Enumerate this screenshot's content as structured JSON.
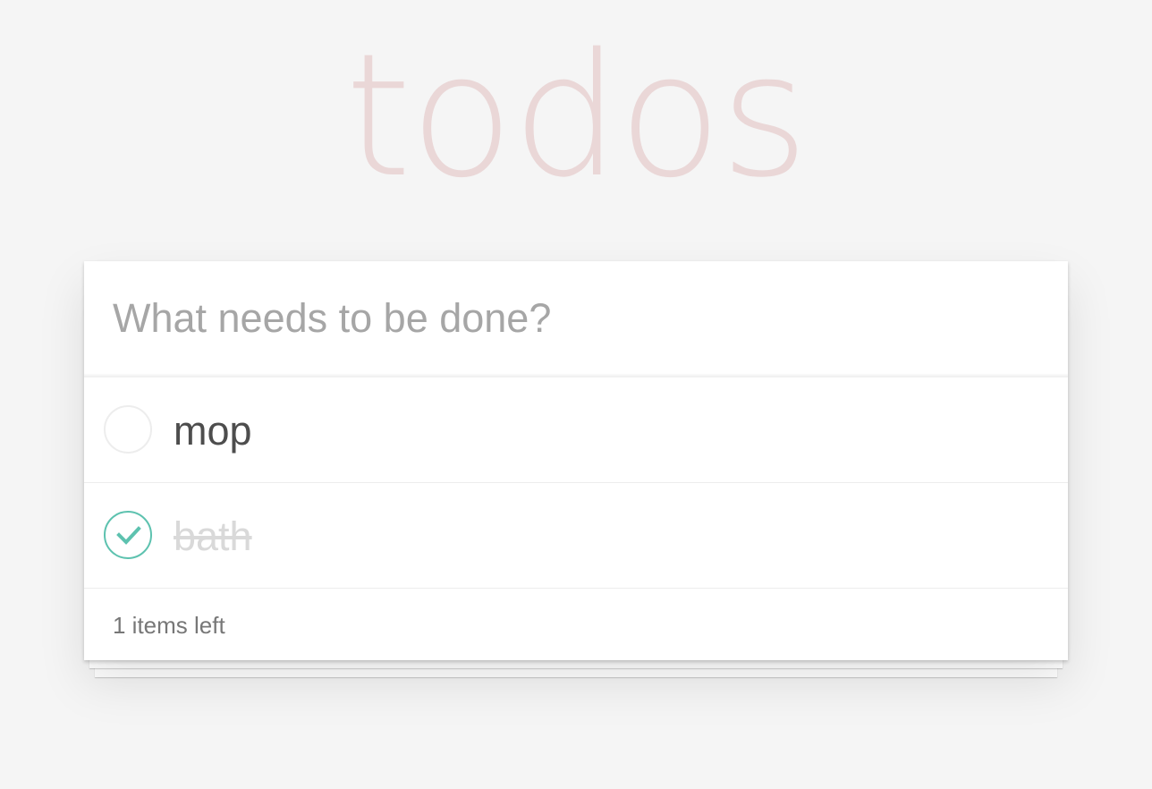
{
  "app": {
    "title": "todos"
  },
  "new_todo": {
    "placeholder": "What needs to be done?",
    "value": ""
  },
  "todos": [
    {
      "label": "mop",
      "completed": false
    },
    {
      "label": "bath",
      "completed": true
    }
  ],
  "footer": {
    "count_text": "1 items left"
  },
  "colors": {
    "background": "#f5f5f5",
    "title": "#eaccd0",
    "check_accent": "#5dc2af",
    "completed_text": "#d9d9d9"
  },
  "icons": {
    "toggle_unchecked": "empty-circle-icon",
    "toggle_checked": "checkmark-circle-icon"
  }
}
